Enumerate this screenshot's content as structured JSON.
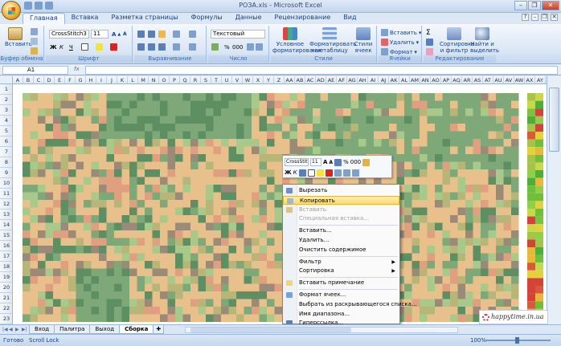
{
  "window": {
    "title": "РОЗА.xls - Microsoft Excel",
    "close_glyph": "✕",
    "min_glyph": "–",
    "max_glyph": "❐"
  },
  "tabs": [
    "Главная",
    "Вставка",
    "Разметка страницы",
    "Формулы",
    "Данные",
    "Рецензирование",
    "Вид"
  ],
  "ribbon": {
    "clipboard": {
      "label": "Буфер обмена",
      "paste": "Вставить"
    },
    "font": {
      "label": "Шрифт",
      "font_name": "CrossStitch3",
      "font_size": "11",
      "bold": "Ж",
      "italic": "К",
      "underline": "Ч"
    },
    "alignment": {
      "label": "Выравнивание"
    },
    "number": {
      "label": "Число",
      "format": "Текстовый",
      "percent": "%",
      "thousands": "000"
    },
    "styles": {
      "label": "Стили",
      "conditional": "Условное форматирование",
      "as_table": "Форматировать как таблицу",
      "cell_styles": "Стили ячеек"
    },
    "cells": {
      "label": "Ячейки",
      "insert": "Вставить",
      "delete": "Удалить",
      "format": "Формат"
    },
    "editing": {
      "label": "Редактирование",
      "sort": "Сортировка и фильтр",
      "find": "Найти и выделить",
      "sigma": "Σ"
    }
  },
  "formula_bar": {
    "name_box": "A1",
    "fx": "fx",
    "value": ""
  },
  "columns": [
    "A",
    "B",
    "C",
    "D",
    "E",
    "F",
    "G",
    "H",
    "I",
    "J",
    "K",
    "L",
    "M",
    "N",
    "O",
    "P",
    "Q",
    "R",
    "S",
    "T",
    "U",
    "V",
    "W",
    "X",
    "Y",
    "Z",
    "AA",
    "AB",
    "AC",
    "AD",
    "AE",
    "AF",
    "AG",
    "AH",
    "AI",
    "AJ",
    "AK",
    "AL",
    "AM",
    "AN",
    "AO",
    "AP",
    "AQ",
    "AR",
    "AS",
    "AT",
    "AU",
    "AV",
    "AW",
    "AX",
    "AY"
  ],
  "rows": [
    "1",
    "2",
    "3",
    "4",
    "5",
    "6",
    "7",
    "8",
    "9",
    "10",
    "11",
    "12",
    "13",
    "14",
    "15",
    "16",
    "17",
    "18",
    "19",
    "20",
    "21",
    "22",
    "23"
  ],
  "mini_toolbar": {
    "font": "CrossStit",
    "size": "11",
    "percent": "%",
    "thousands": "000",
    "bold": "Ж",
    "italic": "К"
  },
  "context_menu": [
    {
      "label": "Вырезать",
      "state": "normal",
      "icon": "scissors-icon"
    },
    {
      "label": "Копировать",
      "state": "highlighted",
      "icon": "copy-icon"
    },
    {
      "label": "Вставить",
      "state": "disabled",
      "icon": "paste-icon"
    },
    {
      "label": "Специальная вставка...",
      "state": "disabled"
    },
    {
      "sep": true
    },
    {
      "label": "Вставить...",
      "state": "normal"
    },
    {
      "label": "Удалить...",
      "state": "normal"
    },
    {
      "label": "Очистить содержимое",
      "state": "normal"
    },
    {
      "sep": true
    },
    {
      "label": "Фильтр",
      "state": "normal",
      "submenu": true
    },
    {
      "label": "Сортировка",
      "state": "normal",
      "submenu": true
    },
    {
      "sep": true
    },
    {
      "label": "Вставить примечание",
      "state": "normal",
      "icon": "comment-icon"
    },
    {
      "sep": true
    },
    {
      "label": "Формат ячеек...",
      "state": "normal",
      "icon": "format-cells-icon"
    },
    {
      "label": "Выбрать из раскрывающегося списка...",
      "state": "normal"
    },
    {
      "label": "Имя диапазона...",
      "state": "normal"
    },
    {
      "label": "Гиперссылка...",
      "state": "normal",
      "icon": "hyperlink-icon"
    }
  ],
  "sheet_tabs": [
    {
      "label": "Вход",
      "active": false
    },
    {
      "label": "Палитра",
      "active": false
    },
    {
      "label": "Выход",
      "active": false
    },
    {
      "label": "Сборка",
      "active": true
    }
  ],
  "status": {
    "ready": "Готово",
    "scroll_lock": "Scroll Lock",
    "zoom": "100%"
  },
  "watermark": {
    "text": "happytime.in.ua"
  },
  "palette": {
    "tan": "#e8c08c",
    "green": "#7fa878",
    "lightgreen": "#a9c98a",
    "olive": "#b8b579",
    "salmon": "#e0a080",
    "darkgreen": "#5e8f63",
    "brown": "#9c8a78"
  }
}
